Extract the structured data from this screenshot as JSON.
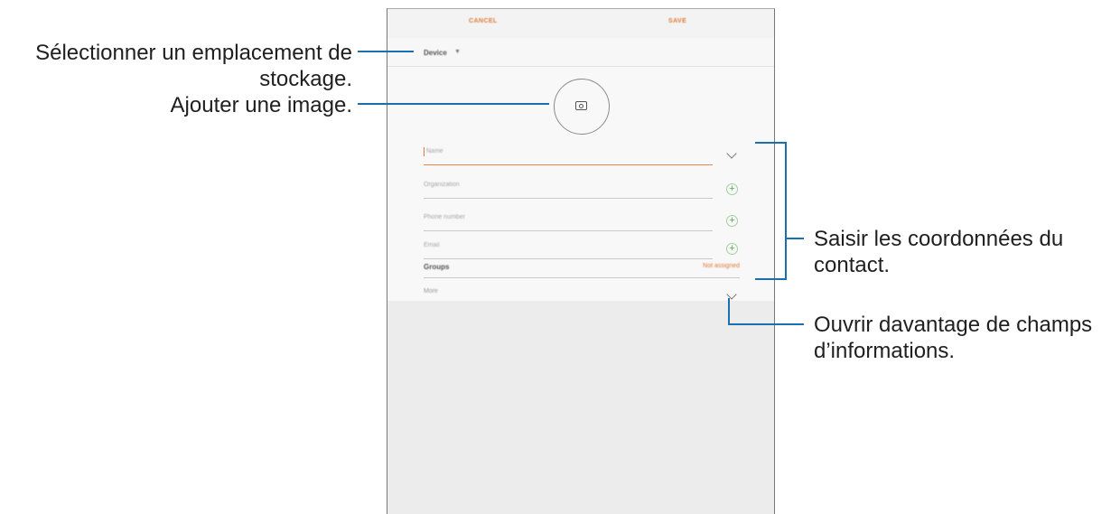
{
  "toolbar": {
    "cancel_label": "CANCEL",
    "save_label": "SAVE"
  },
  "storage": {
    "label": "Device"
  },
  "form": {
    "fields": [
      {
        "placeholder": "Name"
      },
      {
        "placeholder": "Organization"
      },
      {
        "placeholder": "Phone number"
      },
      {
        "placeholder": "Email"
      }
    ],
    "groups_label": "Groups",
    "groups_value": "Not assigned",
    "more_label": "More"
  },
  "annotations": {
    "storage_line1": "Sélectionner un emplacement de",
    "storage_line2": "stockage.",
    "image": "Ajouter une image.",
    "contact_line1": "Saisir les coordonnées du",
    "contact_line2": "contact.",
    "more_line1": "Ouvrir davantage de champs",
    "more_line2": "d’informations."
  },
  "colors": {
    "accent": "#e07a3a",
    "callout_line": "#1a6fae",
    "plus_icon": "#58a858"
  }
}
